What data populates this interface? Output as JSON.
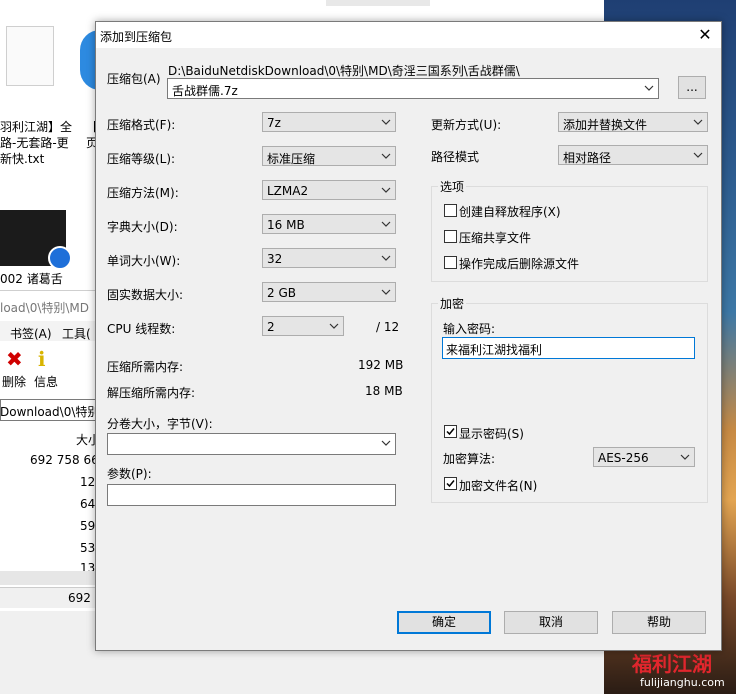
{
  "background": {
    "icon_text_1": "羽利江湖】全",
    "icon_text_2": "路-无套路-更",
    "icon_text_3": "新快.txt",
    "icon_text_4": "【",
    "icon_text_5": "页",
    "icon_text_6": "002 诸葛舌",
    "explorer_path": "load\\0\\特别\\MD",
    "menu_bookmarks": "书签(A)",
    "menu_tools": "工具(",
    "tool_delete": "删除",
    "tool_info": "信息",
    "address": "Download\\0\\特别",
    "col_size": "大小",
    "size_1": "692 758 66",
    "size_2": "12",
    "size_3": "64",
    "size_4": "59",
    "size_5": "53",
    "size_6": "13",
    "status_count": "692",
    "watermark": "福利江湖",
    "watermark_url": "fulijianghu.com"
  },
  "dialog": {
    "title": "添加到压缩包",
    "archive_label": "压缩包(A)",
    "archive_dir": "D:\\BaiduNetdiskDownload\\0\\特别\\MD\\奇淫三国系列\\舌战群儒\\",
    "archive_name": "舌战群儒.7z",
    "browse_label": "...",
    "format_label": "压缩格式(F):",
    "format_value": "7z",
    "level_label": "压缩等级(L):",
    "level_value": "标准压缩",
    "method_label": "压缩方法(M):",
    "method_value": "LZMA2",
    "dict_label": "字典大小(D):",
    "dict_value": "16 MB",
    "word_label": "单词大小(W):",
    "word_value": "32",
    "solid_label": "固实数据大小:",
    "solid_value": "2 GB",
    "cpu_label": "CPU 线程数:",
    "cpu_value": "2",
    "cpu_total": "/ 12",
    "mem_compress_label": "压缩所需内存:",
    "mem_compress_value": "192 MB",
    "mem_decompress_label": "解压缩所需内存:",
    "mem_decompress_value": "18 MB",
    "split_label": "分卷大小，字节(V):",
    "split_value": "",
    "params_label": "参数(P):",
    "params_value": "",
    "update_label": "更新方式(U):",
    "update_value": "添加并替换文件",
    "path_label": "路径模式",
    "path_value": "相对路径",
    "options_title": "选项",
    "opt_sfx": "创建自释放程序(X)",
    "opt_shared": "压缩共享文件",
    "opt_delete": "操作完成后删除源文件",
    "encrypt_title": "加密",
    "password_label": "输入密码:",
    "password_value": "来福利江湖找福利",
    "show_password": "显示密码(S)",
    "enc_method_label": "加密算法:",
    "enc_method_value": "AES-256",
    "enc_names": "加密文件名(N)",
    "ok": "确定",
    "cancel": "取消",
    "help": "帮助"
  }
}
